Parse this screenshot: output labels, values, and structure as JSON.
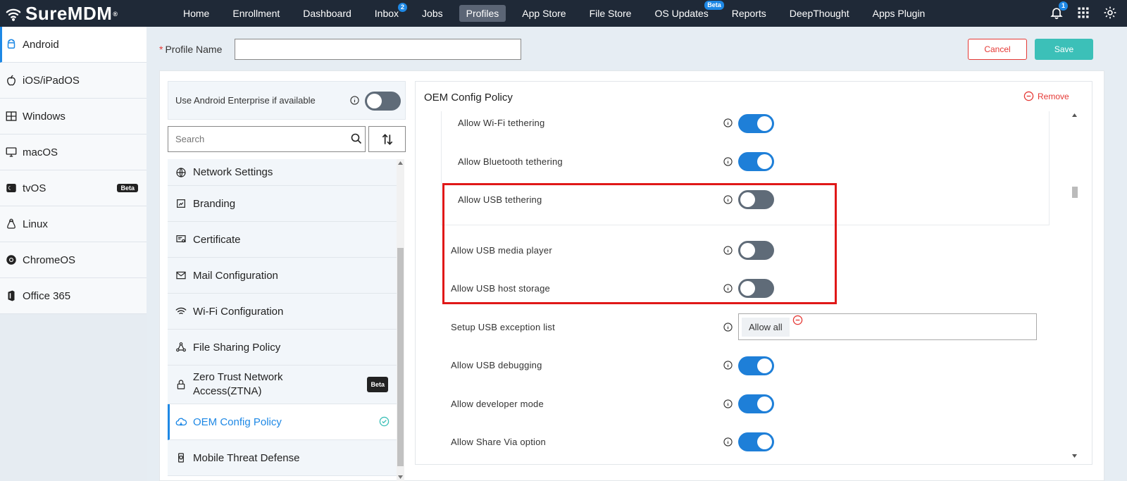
{
  "brand": {
    "name": "SureMDM",
    "mark": "®"
  },
  "nav": {
    "items": [
      {
        "label": "Home"
      },
      {
        "label": "Enrollment"
      },
      {
        "label": "Dashboard"
      },
      {
        "label": "Inbox",
        "badge": "2"
      },
      {
        "label": "Jobs"
      },
      {
        "label": "Profiles",
        "active": true
      },
      {
        "label": "App Store"
      },
      {
        "label": "File Store"
      },
      {
        "label": "OS Updates",
        "beta": "Beta"
      },
      {
        "label": "Reports"
      },
      {
        "label": "DeepThought"
      },
      {
        "label": "Apps Plugin"
      }
    ],
    "notification_count": "1"
  },
  "sidebar": {
    "items": [
      {
        "label": "Android",
        "icon": "android-icon",
        "active": true
      },
      {
        "label": "iOS/iPadOS",
        "icon": "apple-icon"
      },
      {
        "label": "Windows",
        "icon": "windows-icon"
      },
      {
        "label": "macOS",
        "icon": "monitor-icon"
      },
      {
        "label": "tvOS",
        "icon": "tv-icon",
        "beta": "Beta"
      },
      {
        "label": "Linux",
        "icon": "linux-icon"
      },
      {
        "label": "ChromeOS",
        "icon": "chrome-icon"
      },
      {
        "label": "Office 365",
        "icon": "office-icon"
      }
    ]
  },
  "header": {
    "profile_label": "Profile Name",
    "profile_required": "*",
    "profile_value": "",
    "cancel_label": "Cancel",
    "save_label": "Save"
  },
  "left_panel": {
    "android_enterprise_label": "Use Android Enterprise if available",
    "android_enterprise_on": false,
    "search_placeholder": "Search",
    "policies": [
      {
        "label": "Network Settings",
        "icon": "globe-icon"
      },
      {
        "label": "Branding",
        "icon": "branding-icon"
      },
      {
        "label": "Certificate",
        "icon": "certificate-icon"
      },
      {
        "label": "Mail Configuration",
        "icon": "mail-icon"
      },
      {
        "label": "Wi-Fi Configuration",
        "icon": "wifi-icon"
      },
      {
        "label": "File Sharing Policy",
        "icon": "share-icon"
      },
      {
        "label": "Zero Trust Network Access(ZTNA)",
        "icon": "lock-icon",
        "beta": "Beta"
      },
      {
        "label": "OEM Config Policy",
        "icon": "cloud-icon",
        "active": true
      },
      {
        "label": "Mobile Threat Defense",
        "icon": "phone-shield-icon"
      }
    ]
  },
  "oem": {
    "title": "OEM Config Policy",
    "remove_label": "Remove",
    "settings": [
      {
        "label": "Allow Wi-Fi tethering",
        "on": true
      },
      {
        "label": "Allow Bluetooth tethering",
        "on": true
      },
      {
        "label": "Allow USB tethering",
        "on": false
      },
      {
        "label": "Allow USB media player",
        "on": false
      },
      {
        "label": "Allow USB host storage",
        "on": false
      },
      {
        "label": "Setup USB exception list",
        "chip": "Allow all"
      },
      {
        "label": "Allow USB debugging",
        "on": true
      },
      {
        "label": "Allow developer mode",
        "on": true
      },
      {
        "label": "Allow Share Via option",
        "on": true
      }
    ]
  },
  "colors": {
    "topbar": "#1f2937",
    "accent": "#1e88e5",
    "toggle_on": "#1e7fd8",
    "toggle_off": "#5f6b78",
    "save": "#3cc0b8",
    "danger": "#e53935",
    "highlight": "#e01818"
  }
}
